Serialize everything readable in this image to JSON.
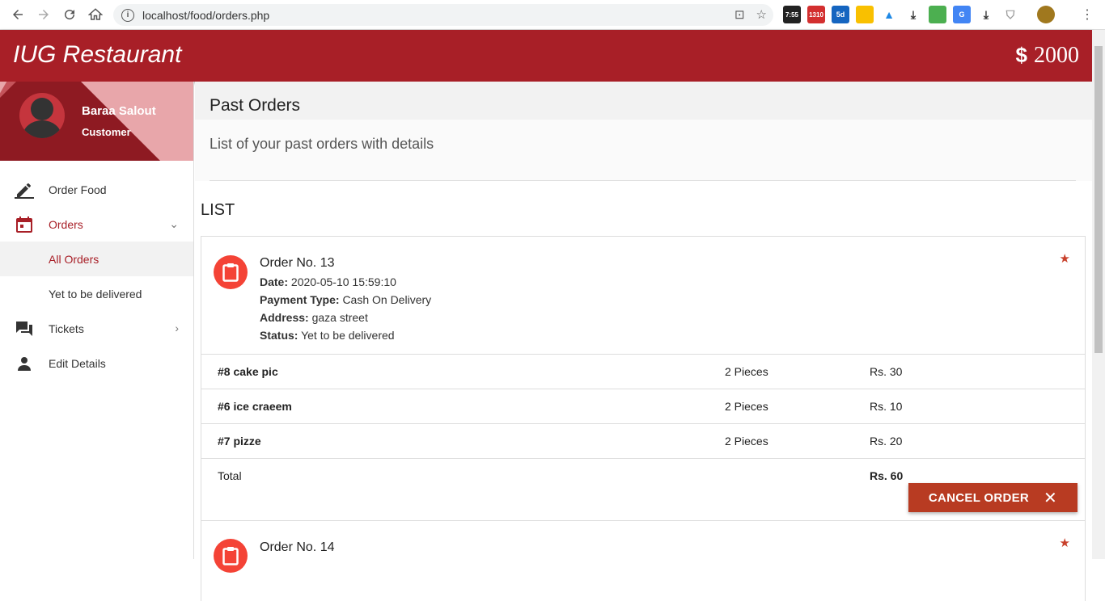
{
  "browser": {
    "url": "localhost/food/orders.php",
    "ext_badges": [
      "7:55",
      "1310",
      "5d"
    ]
  },
  "header": {
    "title": "IUG Restaurant",
    "currency_symbol": "$",
    "balance": "2000"
  },
  "user": {
    "name": "Baraa Salout",
    "role": "Customer"
  },
  "sidebar": {
    "items": [
      {
        "label": "Order Food",
        "icon": "pencil-icon"
      },
      {
        "label": "Orders",
        "icon": "calendar-icon"
      },
      {
        "label": "Tickets",
        "icon": "chat-icon"
      },
      {
        "label": "Edit Details",
        "icon": "person-icon"
      }
    ],
    "sub_items": [
      "All Orders",
      "Yet to be delivered"
    ]
  },
  "page": {
    "title": "Past Orders",
    "subtitle": "List of your past orders with details",
    "list_title": "LIST"
  },
  "orders": [
    {
      "title": "Order No. 13",
      "date_label": "Date:",
      "date": "2020-05-10 15:59:10",
      "payment_label": "Payment Type:",
      "payment": "Cash On Delivery",
      "address_label": "Address:",
      "address": "gaza street",
      "status_label": "Status:",
      "status": "Yet to be delivered",
      "items": [
        {
          "name": "#8 cake pic",
          "qty": "2 Pieces",
          "price": "Rs. 30"
        },
        {
          "name": "#6 ice craeem",
          "qty": "2 Pieces",
          "price": "Rs. 10"
        },
        {
          "name": "#7 pizze",
          "qty": "2 Pieces",
          "price": "Rs. 20"
        }
      ],
      "total_label": "Total",
      "total": "Rs. 60",
      "cancel_label": "CANCEL ORDER"
    },
    {
      "title": "Order No. 14"
    }
  ],
  "colors": {
    "brand": "#a81f27",
    "accent": "#f44336",
    "button": "#b83b22"
  }
}
